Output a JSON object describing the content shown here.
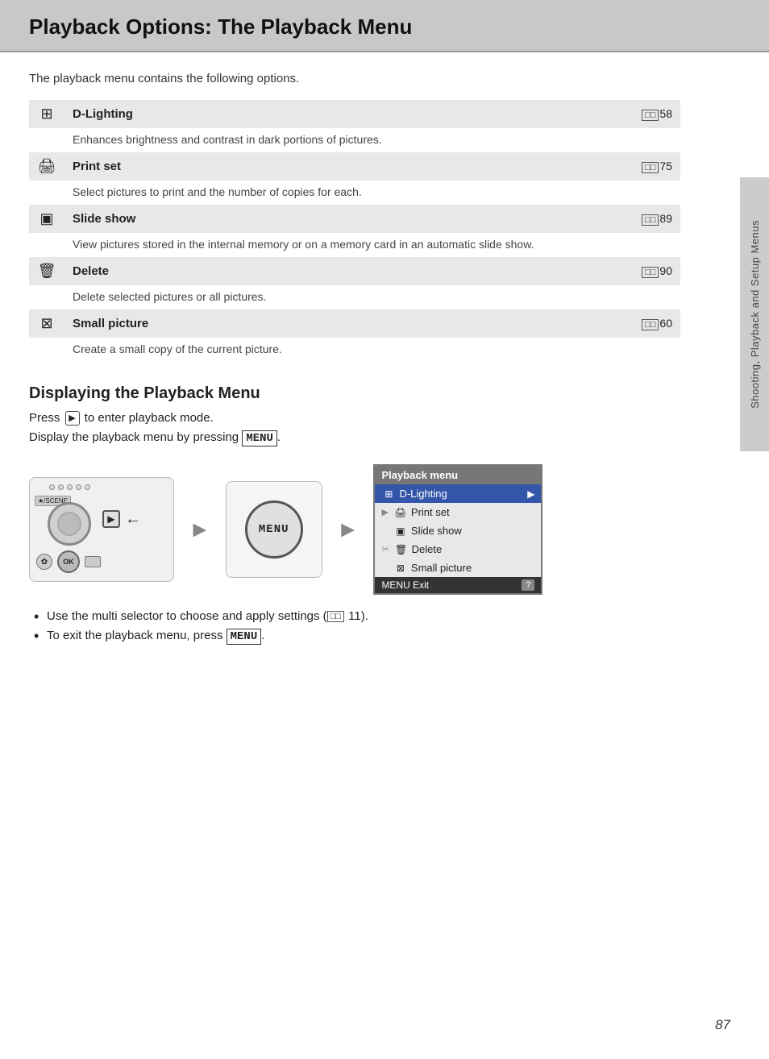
{
  "page": {
    "title": "Playback Options: The Playback Menu",
    "intro": "The playback menu contains the following options.",
    "options": [
      {
        "id": "d-lighting",
        "icon": "⊞",
        "label": "D-Lighting",
        "ref": "58",
        "desc": "Enhances brightness and contrast in dark portions of pictures."
      },
      {
        "id": "print-set",
        "icon": "🖨",
        "label": "Print set",
        "ref": "75",
        "desc": "Select pictures to print and the number of copies for each."
      },
      {
        "id": "slide-show",
        "icon": "▣",
        "label": "Slide show",
        "ref": "89",
        "desc": "View pictures stored in the internal memory or on a memory card in an automatic slide show."
      },
      {
        "id": "delete",
        "icon": "🗑",
        "label": "Delete",
        "ref": "90",
        "desc": "Delete selected pictures or all pictures."
      },
      {
        "id": "small-picture",
        "icon": "⊠",
        "label": "Small picture",
        "ref": "60",
        "desc": "Create a small copy of the current picture."
      }
    ],
    "section2": {
      "heading": "Displaying the Playback Menu",
      "line1": "Press  to enter playback mode.",
      "line2": "Display the playback menu by pressing MENU."
    },
    "playback_menu": {
      "title": "Playback menu",
      "items": [
        {
          "icon": "⊞",
          "label": "D-Lighting",
          "selected": true,
          "has_arrow": true
        },
        {
          "icon": "🖨",
          "label": "Print set",
          "selected": false
        },
        {
          "icon": "▣",
          "label": "Slide show",
          "selected": false
        },
        {
          "icon": "🗑",
          "label": "Delete",
          "selected": false
        },
        {
          "icon": "⊠",
          "label": "Small picture",
          "selected": false
        }
      ],
      "footer": "MENU Exit",
      "help_label": "?"
    },
    "bullets": [
      "Use the multi selector to choose and apply settings (  11).",
      "To exit the playback menu, press MENU."
    ],
    "page_number": "87",
    "sidebar_label": "Shooting, Playback and Setup Menus"
  }
}
